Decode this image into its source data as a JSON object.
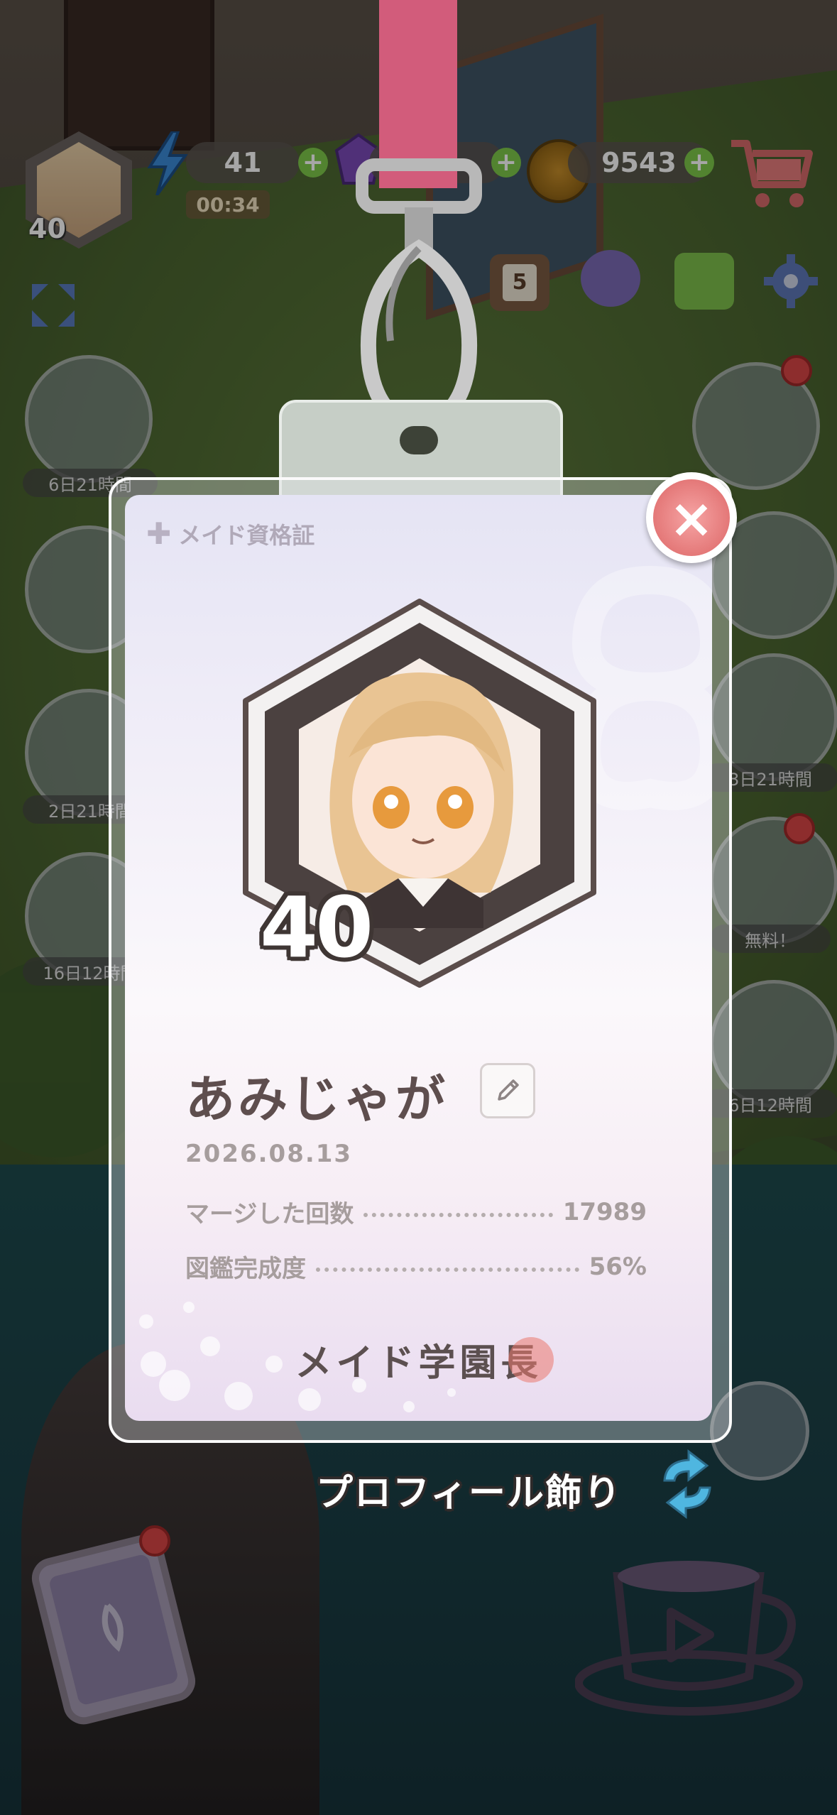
{
  "hud": {
    "level": "40",
    "energy": "41",
    "energy_timer": "00:34",
    "gems": "",
    "coins": "9543",
    "calendar_day": "5",
    "plus": "+"
  },
  "side_events": {
    "left": [
      "6日21時間",
      "",
      "2日21時間",
      "16日12時間"
    ],
    "right": [
      "",
      "",
      "3日21時間",
      "無料！",
      "6日12時間"
    ]
  },
  "card": {
    "title": "メイド資格証",
    "level": "40",
    "player_name": "あみじゃが",
    "date": "2026.08.13",
    "stats": [
      {
        "label": "マージした回数",
        "value": "17989"
      },
      {
        "label": "図鑑完成度",
        "value": "56%"
      }
    ],
    "rank": "メイド学園長"
  },
  "buttons": {
    "close": "×",
    "profile_decoration": "プロフィール飾り"
  },
  "colors": {
    "strap": "#d25c7b",
    "close": "#e47878",
    "name_text": "#5e4e4e",
    "stat_text": "#a69d9d"
  }
}
